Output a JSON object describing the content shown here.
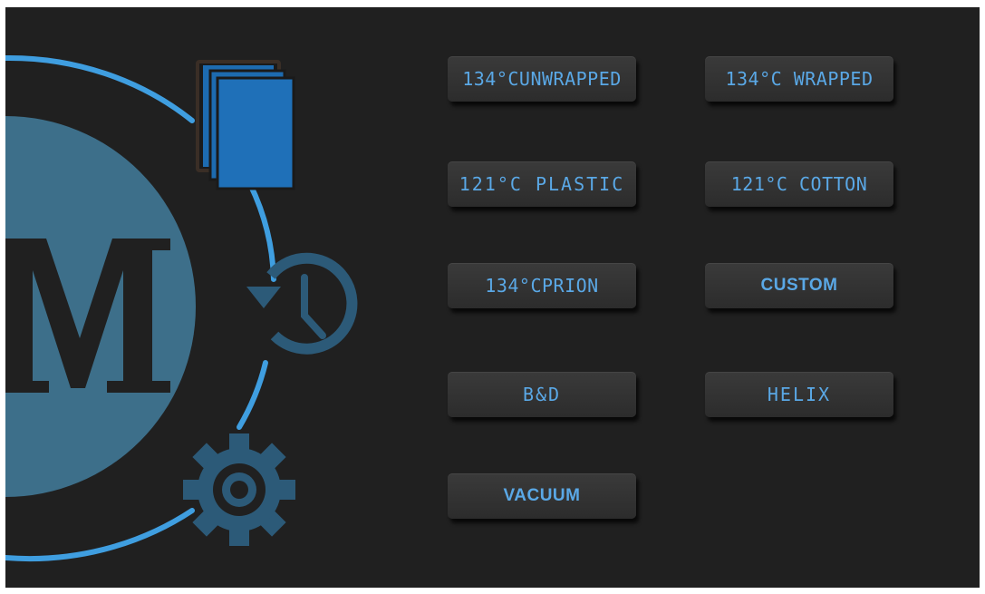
{
  "programs": [
    {
      "label": "134°CUNWRAPPED"
    },
    {
      "label": "134°C WRAPPED"
    },
    {
      "label": "121°C PLASTIC"
    },
    {
      "label": "121°C COTTON"
    },
    {
      "label": "134°CPRION"
    },
    {
      "label": "CUSTOM"
    },
    {
      "label": "B&D"
    },
    {
      "label": "HELIX"
    },
    {
      "label": "VACUUM"
    }
  ],
  "icons": {
    "logo": "m-logo-icon",
    "programs": "documents-icon",
    "history": "history-clock-icon",
    "settings": "gear-icon"
  },
  "colors": {
    "background": "#202020",
    "accent": "#3f9ee0",
    "logo_fill": "#3d6f8a",
    "button_text": "#5aa8e6"
  }
}
